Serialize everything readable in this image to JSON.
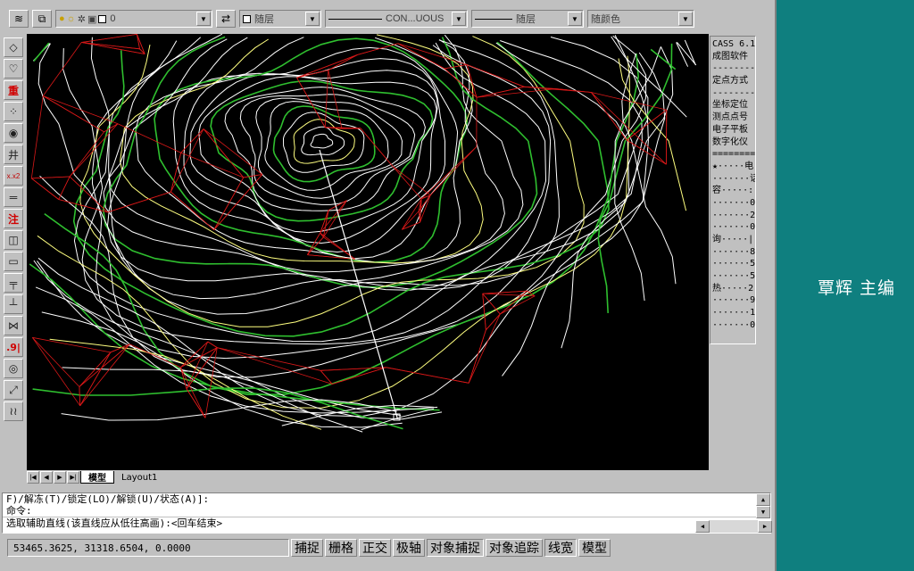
{
  "toolbar": {
    "layer_value": "0",
    "color_value": "随层",
    "linetype_value": "CON...UOUS",
    "lineweight_value": "随层",
    "plotstyle_value": "随颜色"
  },
  "side_menu": {
    "items": [
      "CASS 6.1",
      "成图软件",
      "--------",
      "定点方式",
      "--------",
      "坐标定位",
      "测点点号",
      "电子平板",
      "数字化仪",
      "========",
      "★·····电",
      "·······话",
      "容·····:",
      "·······0",
      "·······2",
      "·······0",
      "询·····|",
      "·······8",
      "·······5",
      "·······5",
      "热·····2",
      "·······9",
      "·······1",
      "·······0"
    ]
  },
  "tabs": {
    "model": "模型",
    "layout1": "Layout1"
  },
  "command": {
    "line1": "F)/解冻(T)/锁定(LO)/解锁(U)/状态(A)]:",
    "line2": "命令:",
    "line3": "选取辅助直线(该直线应从低往高画):<回车结束>"
  },
  "status": {
    "coords": "53465.3625, 31318.6504, 0.0000",
    "buttons": [
      "捕捉",
      "栅格",
      "正交",
      "极轴",
      "对象捕捉",
      "对象追踪",
      "线宽",
      "模型"
    ]
  },
  "author": "覃辉 主编",
  "colors": {
    "contour_major": "#2fbf2f",
    "contour_minor": "#ffffff",
    "contour_accent": "#ffff80",
    "tin_edges": "#d81818",
    "desktop": "#0f7f7f"
  }
}
